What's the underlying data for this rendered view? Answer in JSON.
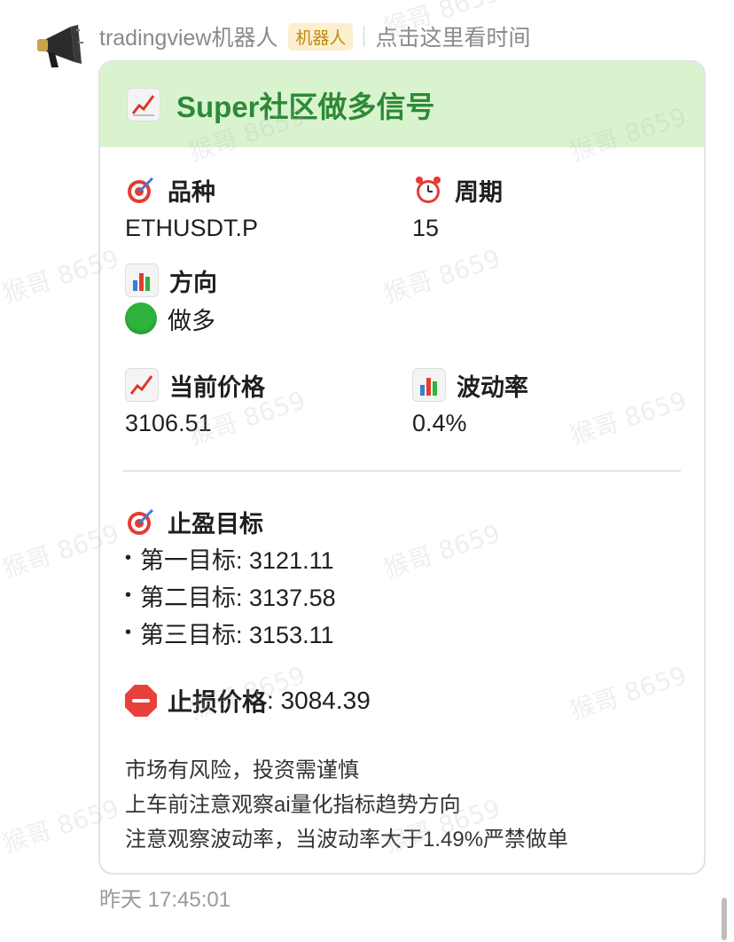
{
  "header": {
    "sender": "tradingview机器人",
    "badge": "机器人",
    "hint": "点击这里看时间"
  },
  "card": {
    "title": "Super社区做多信号",
    "title_color": "#2c8a36",
    "header_bg": "#daf3cf",
    "fields": {
      "symbol": {
        "label": "品种",
        "value": "ETHUSDT.P",
        "icon": "dart-target-icon"
      },
      "period": {
        "label": "周期",
        "value": "15",
        "icon": "alarm-clock-icon"
      },
      "direction": {
        "label": "方向",
        "value": "做多",
        "icon": "bar-chart-icon",
        "status_icon": "green-circle-icon"
      },
      "price": {
        "label": "当前价格",
        "value": "3106.51",
        "icon": "chart-increasing-icon"
      },
      "volatility": {
        "label": "波动率",
        "value": "0.4%",
        "icon": "bar-chart-icon"
      }
    },
    "take_profit": {
      "label": "止盈目标",
      "items": [
        "第一目标: 3121.11",
        "第二目标: 3137.58",
        "第三目标: 3153.11"
      ]
    },
    "stop_loss": {
      "label": "止损价格",
      "value": ": 3084.39"
    },
    "notes": [
      "市场有风险，投资需谨慎",
      "上车前注意观察ai量化指标趋势方向",
      "注意观察波动率，当波动率大于1.49%严禁做单"
    ]
  },
  "timestamp": "昨天 17:45:01",
  "watermark": "猴哥 8659"
}
